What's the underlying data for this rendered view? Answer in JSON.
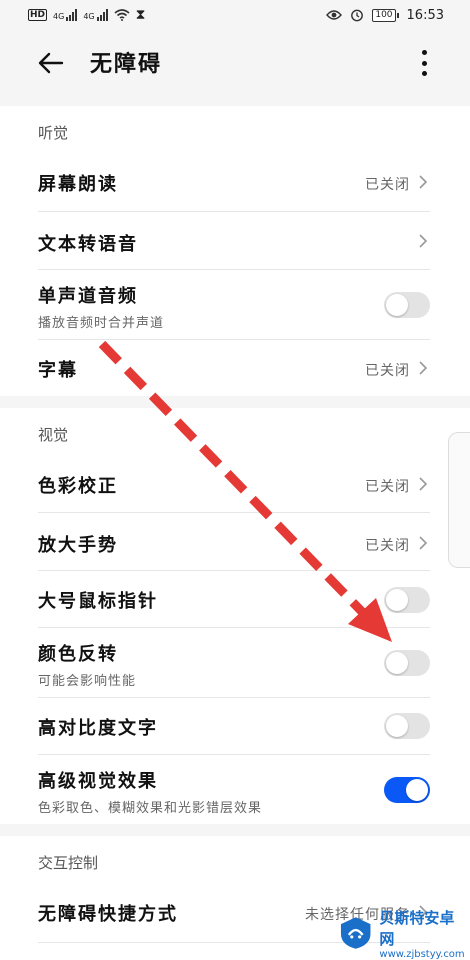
{
  "status": {
    "hd": "HD",
    "net1": "4G",
    "net2": "4G",
    "hourglass": "⧗",
    "time": "16:53",
    "battery": "100",
    "icons": [
      "eye-icon",
      "alarm-icon",
      "wifi-icon",
      "signal-icon"
    ]
  },
  "header": {
    "title": "无障碍"
  },
  "hearing": {
    "title": "听觉",
    "items": [
      {
        "label": "屏幕朗读",
        "value": "已关闭"
      },
      {
        "label": "文本转语音",
        "value": ""
      },
      {
        "label": "单声道音频",
        "subtitle": "播放音频时合并声道",
        "toggle": false
      },
      {
        "label": "字幕",
        "value": "已关闭"
      }
    ]
  },
  "vision": {
    "title": "视觉",
    "items": [
      {
        "label": "色彩校正",
        "value": "已关闭"
      },
      {
        "label": "放大手势",
        "value": "已关闭"
      },
      {
        "label": "大号鼠标指针",
        "toggle": false
      },
      {
        "label": "颜色反转",
        "subtitle": "可能会影响性能",
        "toggle": false
      },
      {
        "label": "高对比度文字",
        "toggle": false
      },
      {
        "label": "高级视觉效果",
        "subtitle": "色彩取色、模糊效果和光影错层效果",
        "toggle": true
      }
    ]
  },
  "interaction": {
    "title": "交互控制",
    "items": [
      {
        "label": "无障碍快捷方式",
        "value": "未选择任何服务"
      }
    ]
  },
  "annotation": {
    "arrow_color": "#e53935"
  },
  "colors": {
    "accent": "#0a59f7",
    "toggle_off": "#e3e3e3"
  },
  "watermark": {
    "name": "贝斯特安卓网",
    "url": "www.zjbstyy.com"
  }
}
